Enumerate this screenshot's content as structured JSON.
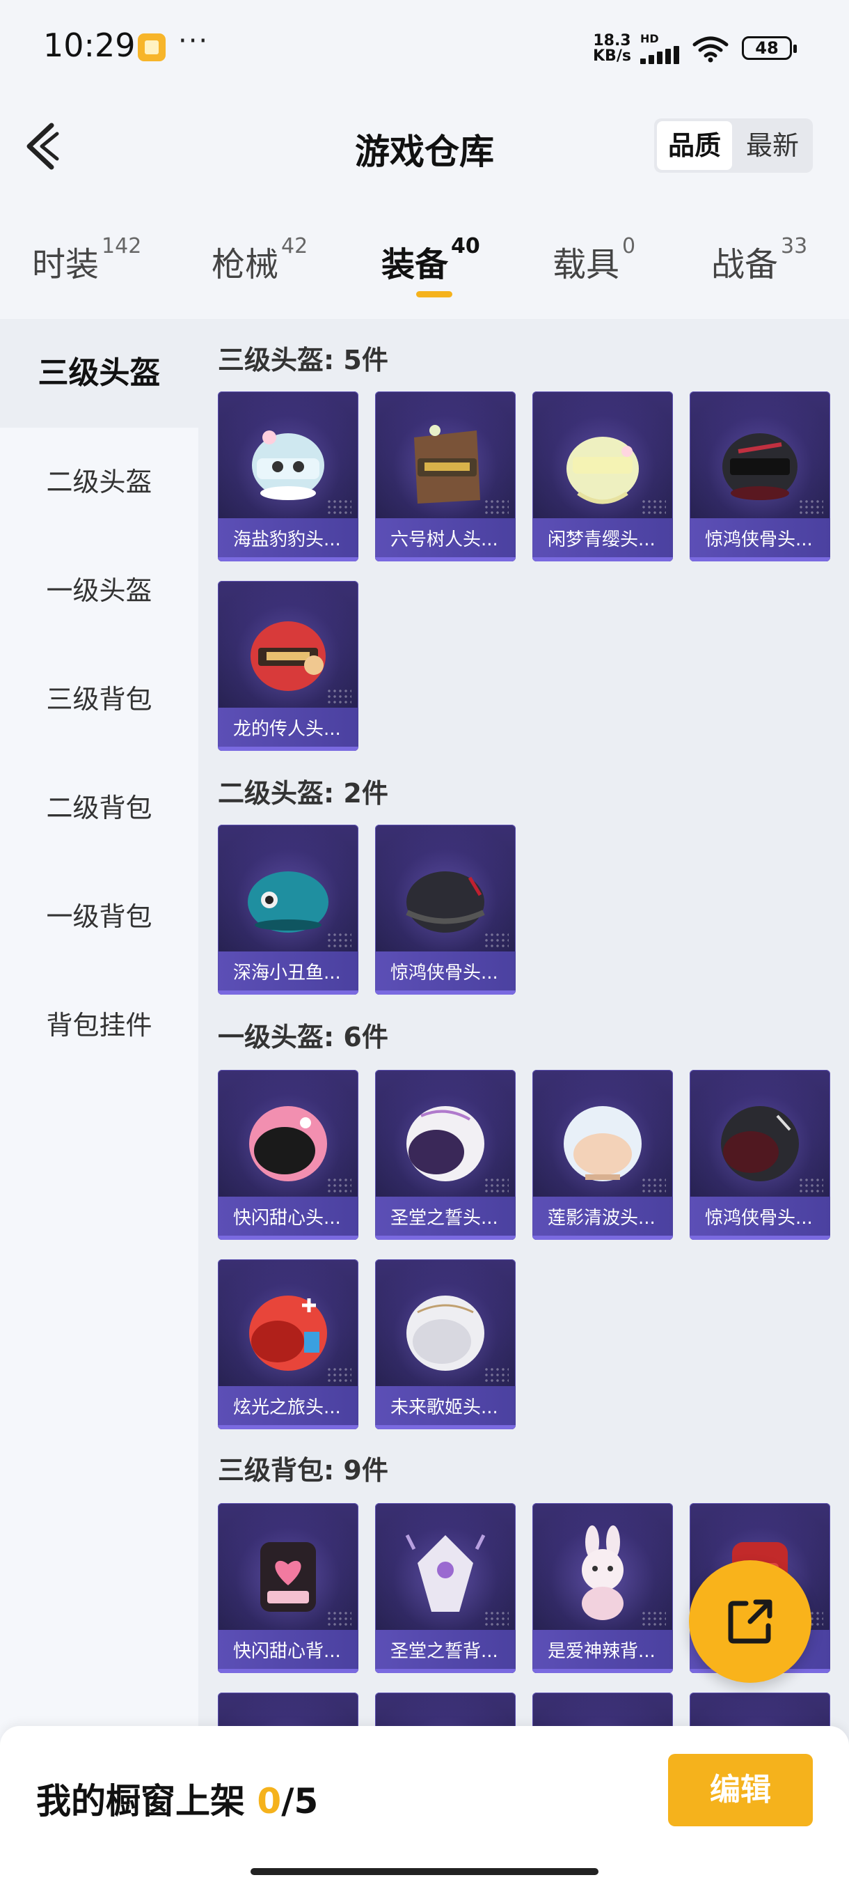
{
  "status_bar": {
    "time": "10:29",
    "more": "···",
    "net_speed": "18.3",
    "net_unit": "KB/s",
    "hd": "HD",
    "battery": "48"
  },
  "header": {
    "title": "游戏仓库",
    "sort_active": "品质",
    "sort_inactive": "最新"
  },
  "tabs": [
    {
      "label": "时装",
      "count": "142"
    },
    {
      "label": "枪械",
      "count": "42"
    },
    {
      "label": "装备",
      "count": "40"
    },
    {
      "label": "载具",
      "count": "0"
    },
    {
      "label": "战备",
      "count": "33"
    }
  ],
  "sidebar": [
    {
      "label": "三级头盔"
    },
    {
      "label": "二级头盔"
    },
    {
      "label": "一级头盔"
    },
    {
      "label": "三级背包"
    },
    {
      "label": "二级背包"
    },
    {
      "label": "一级背包"
    },
    {
      "label": "背包挂件"
    }
  ],
  "sections": [
    {
      "title": "三级头盔: 5件",
      "items": [
        "海盐豹豹头...",
        "六号树人头...",
        "闲梦青缨头...",
        "惊鸿侠骨头...",
        "龙的传人头..."
      ]
    },
    {
      "title": "二级头盔: 2件",
      "items": [
        "深海小丑鱼...",
        "惊鸿侠骨头..."
      ]
    },
    {
      "title": "一级头盔: 6件",
      "items": [
        "快闪甜心头...",
        "圣堂之誓头...",
        "莲影清波头...",
        "惊鸿侠骨头...",
        "炫光之旅头...",
        "未来歌姬头..."
      ]
    },
    {
      "title": "三级背包: 9件",
      "items": [
        "快闪甜心背...",
        "圣堂之誓背...",
        "是爱神辣背...",
        ""
      ]
    }
  ],
  "bottom_bar": {
    "title_prefix": "我的橱窗上架 ",
    "count": "0",
    "total": "/5",
    "edit_label": "编辑"
  },
  "colors": {
    "accent": "#f5b21c",
    "card_bg": "#2b2558",
    "card_label": "#5c4fb6"
  }
}
